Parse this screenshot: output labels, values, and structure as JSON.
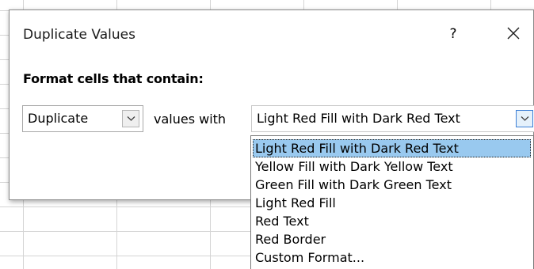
{
  "dialog": {
    "title": "Duplicate Values",
    "help_label": "?",
    "section_label": "Format cells that contain:",
    "rule_type": {
      "value": "Duplicate"
    },
    "values_with_label": "values with",
    "format": {
      "value": "Light Red Fill with Dark Red Text",
      "options": [
        "Light Red Fill with Dark Red Text",
        "Yellow Fill with Dark Yellow Text",
        "Green Fill with Dark Green Text",
        "Light Red Fill",
        "Red Text",
        "Red Border",
        "Custom Format..."
      ],
      "selected_index": 0
    }
  },
  "colors": {
    "selection_highlight": "#99c9ef",
    "dropdown_arrow_active": "#e5f1fb",
    "grid_line": "#d4d4d4"
  }
}
